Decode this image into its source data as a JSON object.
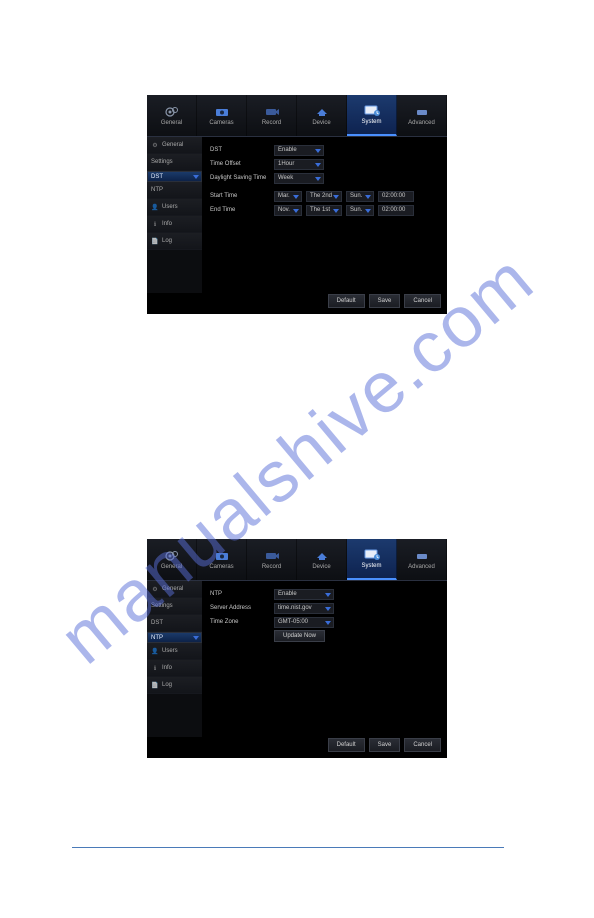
{
  "watermark": "manualshive.com",
  "tabs": {
    "general": "General",
    "cameras": "Cameras",
    "record": "Record",
    "device": "Device",
    "system": "System",
    "advanced": "Advanced"
  },
  "sidebar1": {
    "general": "General",
    "settings": "Settings",
    "dst": "DST",
    "ntp": "NTP",
    "users": "Users",
    "info": "Info",
    "log": "Log"
  },
  "sidebar2": {
    "general": "General",
    "settings": "Settings",
    "dst": "DST",
    "ntp": "NTP",
    "users": "Users",
    "info": "Info",
    "log": "Log"
  },
  "panel1": {
    "dst_label": "DST",
    "dst_value": "Enable",
    "time_offset_label": "Time Offset",
    "time_offset_value": "1Hour",
    "dst_mode_label": "Daylight Saving Time",
    "dst_mode_value": "Week",
    "start_time_label": "Start Time",
    "start_month": "Mar.",
    "start_week": "The 2nd",
    "start_day": "Sun.",
    "start_time": "02:00:00",
    "end_time_label": "End Time",
    "end_month": "Nov.",
    "end_week": "The 1st",
    "end_day": "Sun.",
    "end_time": "02:00:00"
  },
  "panel2": {
    "ntp_label": "NTP",
    "ntp_value": "Enable",
    "server_label": "Server Address",
    "server_value": "time.nist.gov",
    "tz_label": "Time Zone",
    "tz_value": "GMT-05:00",
    "update_btn": "Update Now"
  },
  "buttons": {
    "default": "Default",
    "save": "Save",
    "cancel": "Cancel"
  }
}
